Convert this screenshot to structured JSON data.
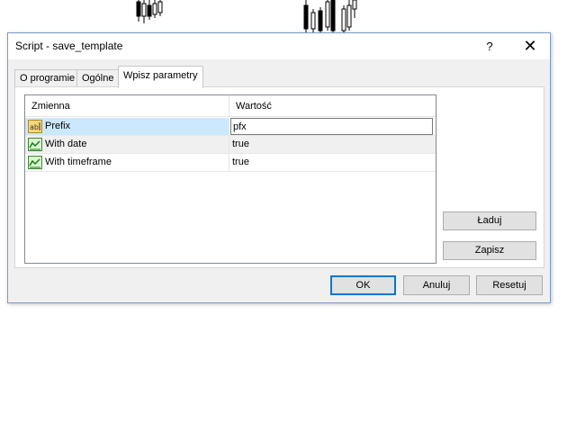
{
  "window": {
    "title": "Script - save_template"
  },
  "titlebar": {
    "help_label": "?",
    "close_label": "✕"
  },
  "tabs": [
    {
      "label": "O programie"
    },
    {
      "label": "Ogólne"
    },
    {
      "label": "Wpisz parametry",
      "active": true
    }
  ],
  "grid": {
    "columns": [
      "Zmienna",
      "Wartość"
    ],
    "rows": [
      {
        "name": "Prefix",
        "value": "pfx",
        "icon": "text-ab-icon",
        "editing": true
      },
      {
        "name": "With date",
        "value": "true",
        "icon": "boolean-chart-icon"
      },
      {
        "name": "With timeframe",
        "value": "true",
        "icon": "boolean-chart-icon"
      }
    ]
  },
  "side_buttons": {
    "load_label": "Ładuj",
    "save_label": "Zapisz"
  },
  "footer": {
    "ok_label": "OK",
    "cancel_label": "Anuluj",
    "reset_label": "Resetuj"
  },
  "colors": {
    "selection": "#cce8ff",
    "accent": "#0078d7",
    "dialog_bg": "#f0f0f0"
  }
}
